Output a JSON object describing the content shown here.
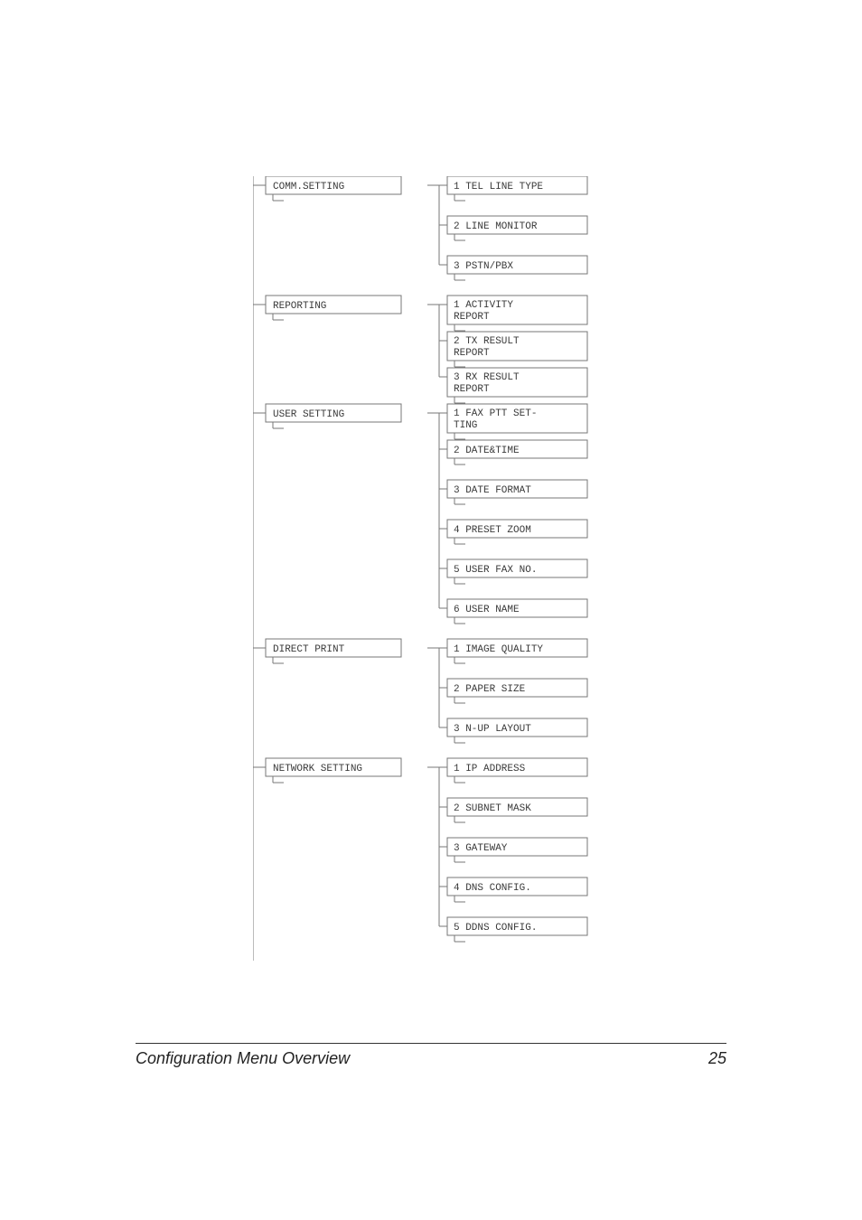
{
  "diagram": {
    "groups": [
      {
        "parent": "COMM.SETTING",
        "children": [
          "1 TEL LINE TYPE",
          "2 LINE MONITOR",
          "3 PSTN/PBX"
        ]
      },
      {
        "parent": "REPORTING",
        "children": [
          "1 ACTIVITY REPORT",
          "2 TX RESULT REPORT",
          "3 RX RESULT REPORT"
        ]
      },
      {
        "parent": "USER SETTING",
        "children": [
          "1 FAX PTT SET-TING",
          "2 DATE&TIME",
          "3 DATE FORMAT",
          "4 PRESET ZOOM",
          "5 USER FAX NO.",
          "6 USER NAME"
        ]
      },
      {
        "parent": "DIRECT PRINT",
        "children": [
          "1 IMAGE QUALITY",
          "2 PAPER SIZE",
          "3 N-UP LAYOUT"
        ]
      },
      {
        "parent": "NETWORK SETTING",
        "children": [
          "1 IP ADDRESS",
          "2 SUBNET MASK",
          "3 GATEWAY",
          "4 DNS CONFIG.",
          "5 DDNS CONFIG."
        ]
      }
    ]
  },
  "footer": {
    "title": "Configuration Menu Overview",
    "page": "25"
  }
}
